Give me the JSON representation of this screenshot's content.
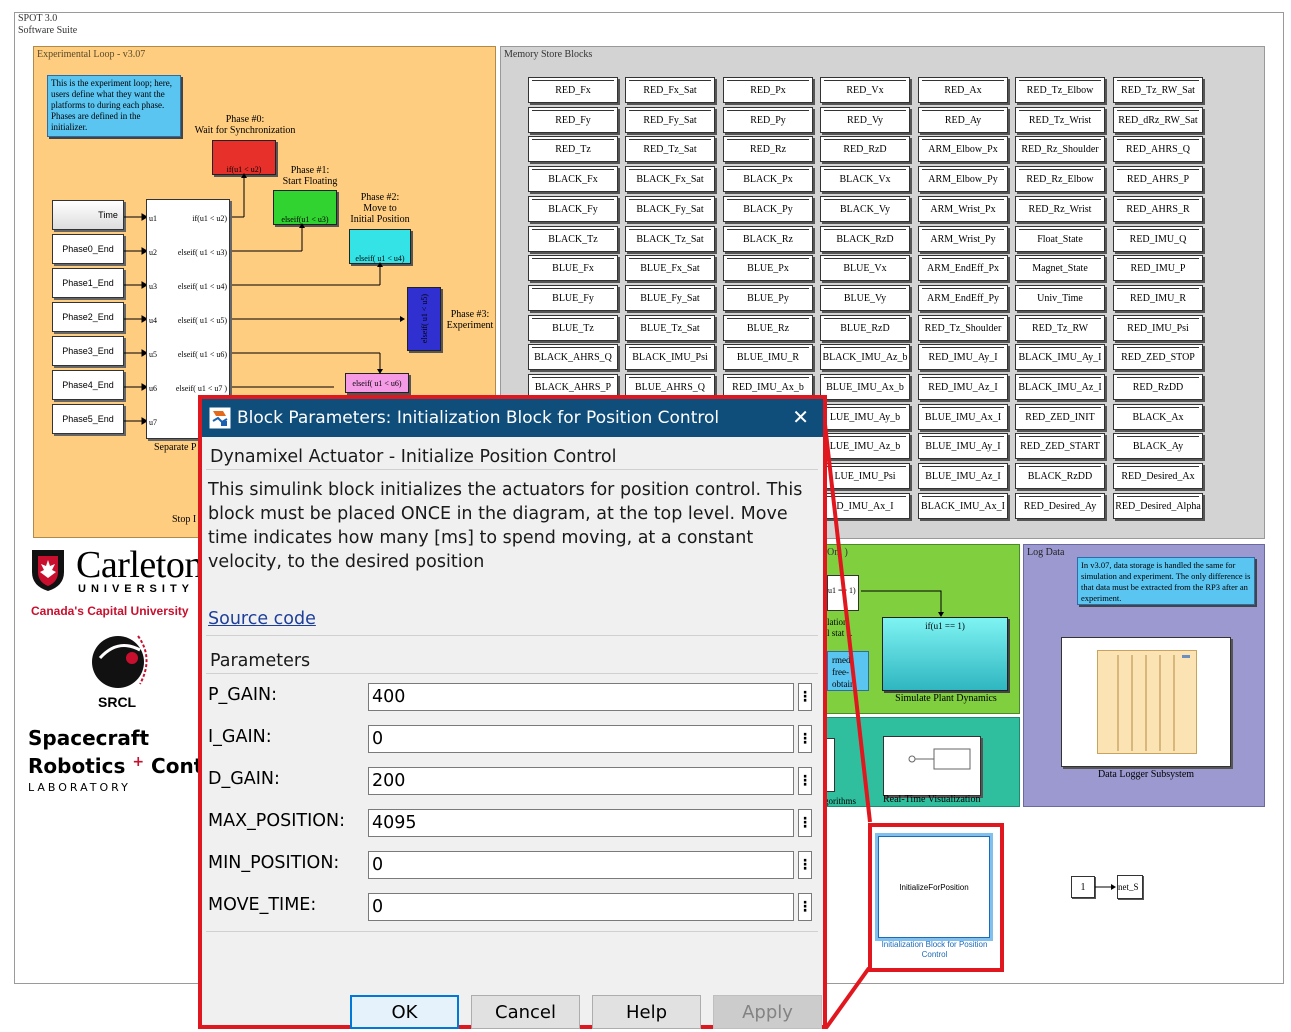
{
  "suite": {
    "line1": "SPOT 3.0",
    "line2": "Software Suite"
  },
  "experimental_loop": {
    "title": "Experimental Loop - v3.07",
    "note": "This is the experiment loop; here, users define what they want the platforms to during each phase. Phases are defined in the initializer.",
    "phases": [
      {
        "label": "Phase #0:\nWait for Synchronization",
        "block": "if(u1 < u2)",
        "color": "#e8302a"
      },
      {
        "label": "Phase #1:\nStart Floating",
        "block": "elseif(u1 < u3)",
        "color": "#31d331"
      },
      {
        "label": "Phase #2:\nMove to\nInitial Position",
        "block": "elseif( u1 < u4)",
        "color": "#33e3e6"
      },
      {
        "label": "Phase #3:\nExperiment",
        "block": "elseif( u1 < u5)",
        "color": "#3030d0"
      },
      {
        "label": "",
        "block": "elseif( u1 < u6)",
        "color": "#f59be6"
      }
    ],
    "inputs": [
      "Time",
      "Phase0_End",
      "Phase1_End",
      "Phase2_End",
      "Phase3_End",
      "Phase4_End",
      "Phase5_End"
    ],
    "switch_in_ports": [
      "u1",
      "u2",
      "u3",
      "u4",
      "u5",
      "u6",
      "u7"
    ],
    "switch_out_ports": [
      "if(u1 < u2)",
      "elseif( u1 < u3)",
      "elseif( u1 < u4)",
      "elseif( u1 < u5)",
      "elseif( u1 < u6)",
      "elseif( u1 < u7 )"
    ],
    "separate_label": "Separate P",
    "stop_label": "Stop I"
  },
  "memory_store": {
    "title": "Memory Store Blocks",
    "columns": [
      [
        "RED_Fx",
        "RED_Fy",
        "RED_Tz",
        "BLACK_Fx",
        "BLACK_Fy",
        "BLACK_Tz",
        "BLUE_Fx",
        "BLUE_Fy",
        "BLUE_Tz",
        "BLACK_AHRS_Q",
        "BLACK_AHRS_P"
      ],
      [
        "RED_Fx_Sat",
        "RED_Fy_Sat",
        "RED_Tz_Sat",
        "BLACK_Fx_Sat",
        "BLACK_Fy_Sat",
        "BLACK_Tz_Sat",
        "BLUE_Fx_Sat",
        "BLUE_Fy_Sat",
        "BLUE_Tz_Sat",
        "BLACK_IMU_Psi",
        "BLUE_AHRS_Q"
      ],
      [
        "RED_Px",
        "RED_Py",
        "RED_Rz",
        "BLACK_Px",
        "BLACK_Py",
        "BLACK_Rz",
        "BLUE_Px",
        "BLUE_Py",
        "BLUE_Rz",
        "BLUE_IMU_R",
        "RED_IMU_Ax_b"
      ],
      [
        "RED_Vx",
        "RED_Vy",
        "RED_RzD",
        "BLACK_Vx",
        "BLACK_Vy",
        "BLACK_RzD",
        "BLUE_Vx",
        "BLUE_Vy",
        "BLUE_RzD",
        "BLACK_IMU_Az_b",
        "BLUE_IMU_Ax_b",
        "LUE_IMU_Ay_b",
        "LUE_IMU_Az_b",
        "LUE_IMU_Psi",
        "D_IMU_Ax_I"
      ],
      [
        "RED_Ax",
        "RED_Ay",
        "ARM_Elbow_Px",
        "ARM_Elbow_Py",
        "ARM_Wrist_Px",
        "ARM_Wrist_Py",
        "ARM_EndEff_Px",
        "ARM_EndEff_Py",
        "RED_Tz_Shoulder",
        "RED_IMU_Ay_I",
        "RED_IMU_Az_I",
        "BLUE_IMU_Ax_I",
        "BLUE_IMU_Ay_I",
        "BLUE_IMU_Az_I",
        "BLACK_IMU_Ax_I"
      ],
      [
        "RED_Tz_Elbow",
        "RED_Tz_Wrist",
        "RED_Rz_Shoulder",
        "RED_Rz_Elbow",
        "RED_Rz_Wrist",
        "Float_State",
        "Magnet_State",
        "Univ_Time",
        "RED_Tz_RW",
        "BLACK_IMU_Ay_I",
        "BLACK_IMU_Az_I",
        "RED_ZED_INIT",
        "RED_ZED_START",
        "BLACK_RzDD",
        "RED_Desired_Ay"
      ],
      [
        "RED_Tz_RW_Sat",
        "RED_dRz_RW_Sat",
        "RED_AHRS_Q",
        "RED_AHRS_P",
        "RED_AHRS_R",
        "RED_IMU_Q",
        "RED_IMU_P",
        "RED_IMU_R",
        "RED_IMU_Psi",
        "RED_ZED_STOP",
        "RED_RzDD",
        "BLACK_Ax",
        "BLACK_Ay",
        "RED_Desired_Ax",
        "RED_Desired_Alpha"
      ]
    ]
  },
  "sim_area": {
    "title_fragment": "Onl )",
    "switch_label": "if(u1 == 1)",
    "plant_label": "Simulate Plant Dynamics",
    "left_texts": [
      "u1 == 1)",
      "lation",
      "l stat s.",
      "rmed",
      "free-",
      "obtain"
    ],
    "algorithms_label": "gorithms",
    "viz_label": "Real-Time Visualization"
  },
  "log_area": {
    "title": "Log Data",
    "note": "In v3.07, data storage is handled the same for simulation and experiment. The only difference is that data must be extracted from the RP3 after an experiment.",
    "subsystem_label": "Data Logger Subsystem"
  },
  "init_block": {
    "inner_text": "InitializeForPosition",
    "caption": "Initialization Block for Position Control"
  },
  "constant_block": {
    "value": "1",
    "target": "net_S"
  },
  "logo": {
    "university": "Carleton",
    "university_sub": "UNIVERSITY",
    "tagline": "Canada's Capital University",
    "lab_abbrev": "SRCL",
    "lab_line1": "Spacecraft",
    "lab_line2": "Robotics",
    "lab_line2b": "Contro",
    "lab_line3": "LABORATORY"
  },
  "dialog": {
    "title": "Block Parameters: Initialization Block for Position Control",
    "heading": "Dynamixel Actuator - Initialize Position Control",
    "description": "This simulink block initializes the actuators for position control. This block must be placed ONCE in the diagram, at the top level. Move time indicates how many [ms] to spend moving, at a constant velocity, to the desired position",
    "source_link": "Source code",
    "params_heading": "Parameters",
    "params": [
      {
        "label": "P_GAIN:",
        "value": "400"
      },
      {
        "label": "I_GAIN:",
        "value": "0"
      },
      {
        "label": "D_GAIN:",
        "value": "200"
      },
      {
        "label": "MAX_POSITION:",
        "value": "4095"
      },
      {
        "label": "MIN_POSITION:",
        "value": "0"
      },
      {
        "label": "MOVE_TIME:",
        "value": "0"
      }
    ],
    "buttons": {
      "ok": "OK",
      "cancel": "Cancel",
      "help": "Help",
      "apply": "Apply"
    }
  }
}
